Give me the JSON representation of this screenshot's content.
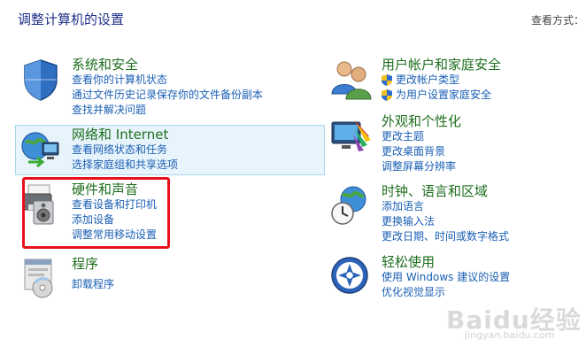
{
  "page": {
    "title": "调整计算机的设置",
    "view_by": "查看方式："
  },
  "left": [
    {
      "title": "系统和安全",
      "links": [
        "查看你的计算机状态",
        "通过文件历史记录保存你的文件备份副本",
        "查找并解决问题"
      ]
    },
    {
      "title": "网络和 Internet",
      "links": [
        "查看网络状态和任务",
        "选择家庭组和共享选项"
      ]
    },
    {
      "title": "硬件和声音",
      "links": [
        "查看设备和打印机",
        "添加设备",
        "调整常用移动设置"
      ]
    },
    {
      "title": "程序",
      "links": [
        "卸载程序"
      ]
    }
  ],
  "right": [
    {
      "title": "用户帐户和家庭安全",
      "links": [
        "更改帐户类型",
        "为用户设置家庭安全"
      ]
    },
    {
      "title": "外观和个性化",
      "links": [
        "更改主题",
        "更改桌面背景",
        "调整屏幕分辨率"
      ]
    },
    {
      "title": "时钟、语言和区域",
      "links": [
        "添加语言",
        "更换输入法",
        "更改日期、时间或数字格式"
      ]
    },
    {
      "title": "轻松使用",
      "links": [
        "使用 Windows 建议的设置",
        "优化视觉显示"
      ]
    }
  ],
  "watermark": {
    "brand": "Baidu经验",
    "url": "jingyan.baidu.com"
  }
}
